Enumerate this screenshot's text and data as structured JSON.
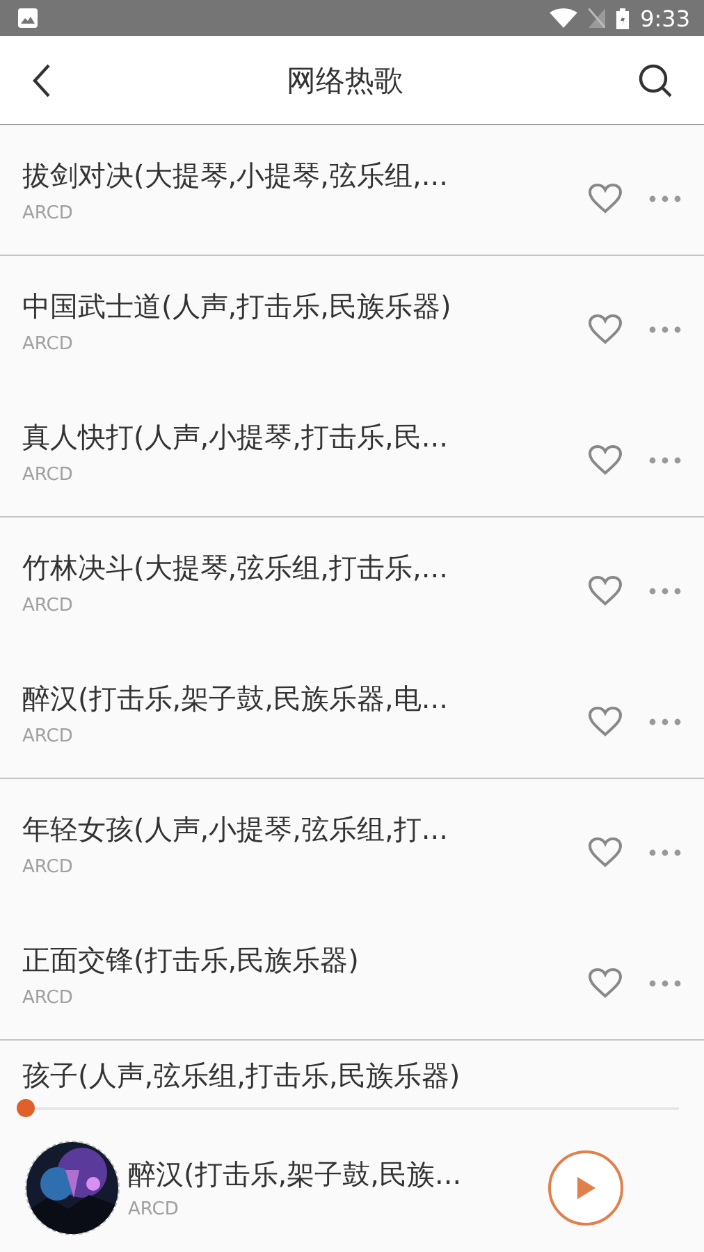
{
  "status_bar": {
    "time": "9:33"
  },
  "header": {
    "title": "网络热歌"
  },
  "songs": [
    {
      "title": "拔剑对决(大提琴,小提琴,弦乐组,...",
      "artist": "ARCD",
      "liked": false,
      "divider_below": true
    },
    {
      "title": "中国武士道(人声,打击乐,民族乐器)",
      "artist": "ARCD",
      "liked": false,
      "divider_below": false
    },
    {
      "title": "真人快打(人声,小提琴,打击乐,民...",
      "artist": "ARCD",
      "liked": false,
      "divider_below": true
    },
    {
      "title": "竹林决斗(大提琴,弦乐组,打击乐,...",
      "artist": "ARCD",
      "liked": false,
      "divider_below": false
    },
    {
      "title": "醉汉(打击乐,架子鼓,民族乐器,电...",
      "artist": "ARCD",
      "liked": false,
      "divider_below": true
    },
    {
      "title": "年轻女孩(人声,小提琴,弦乐组,打...",
      "artist": "ARCD",
      "liked": false,
      "divider_below": false
    },
    {
      "title": "正面交锋(打击乐,民族乐器)",
      "artist": "ARCD",
      "liked": false,
      "divider_below": true
    },
    {
      "kind": "partial",
      "title": "孩子(人声,弦乐组,打击乐,民族乐器)"
    }
  ],
  "player": {
    "level": 0,
    "title": "醉汉(打击乐,架子鼓,民族...",
    "artist": "ARCD",
    "playing": false
  }
}
